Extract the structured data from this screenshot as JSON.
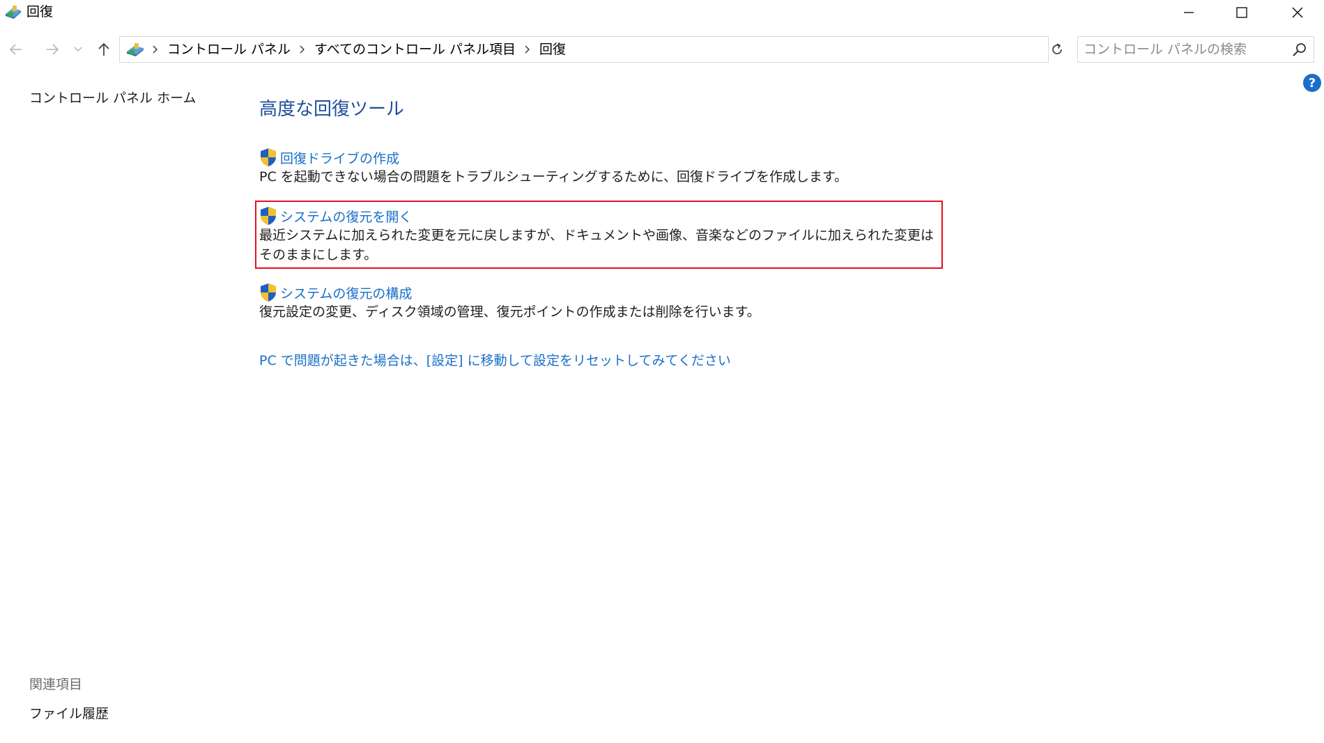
{
  "window": {
    "title": "回復",
    "accent_color": "#1a6fc9",
    "highlight_color": "#e3101e"
  },
  "address": {
    "crumbs": [
      "コントロール パネル",
      "すべてのコントロール パネル項目",
      "回復"
    ]
  },
  "search": {
    "placeholder": "コントロール パネルの検索",
    "value": ""
  },
  "left_pane": {
    "home_link": "コントロール パネル ホーム",
    "related_heading": "関連項目",
    "related_links": [
      "ファイル履歴"
    ]
  },
  "main": {
    "heading": "高度な回復ツール",
    "tools": [
      {
        "link": "回復ドライブの作成",
        "description": "PC を起動できない場合の問題をトラブルシューティングするために、回復ドライブを作成します。",
        "icon": "uac-shield-icon"
      },
      {
        "link": "システムの復元を開く",
        "description": "最近システムに加えられた変更を元に戻しますが、ドキュメントや画像、音楽などのファイルに加えられた変更はそのままにします。",
        "icon": "uac-shield-icon",
        "highlighted": true
      },
      {
        "link": "システムの復元の構成",
        "description": "復元設定の変更、ディスク領域の管理、復元ポイントの作成または削除を行います。",
        "icon": "uac-shield-icon"
      }
    ],
    "reset_link": "PC で問題が起きた場合は、[設定] に移動して設定をリセットしてみてください"
  }
}
